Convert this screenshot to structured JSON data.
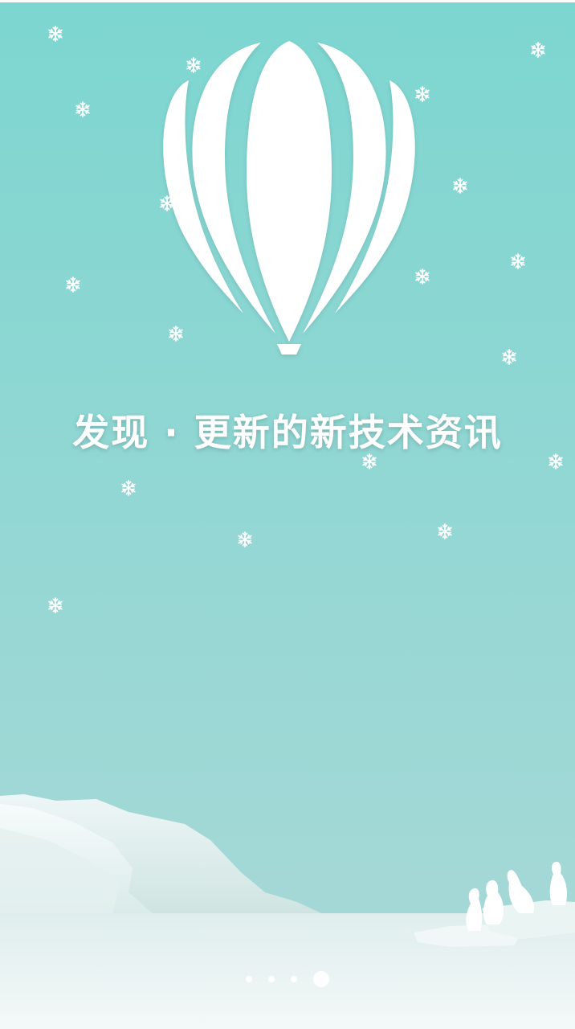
{
  "slogan": "发现 · 更新的新技术资讯",
  "pager": {
    "total": 4,
    "current": 4
  },
  "icons": {
    "balloon": "hot-air-balloon-icon",
    "snowflake": "snowflake-icon",
    "penguins": "penguins-icon",
    "iceberg": "iceberg-icon"
  },
  "colors": {
    "sky_top": "#7dd6d0",
    "sky_bottom": "#a8d9d7",
    "snow": "#ffffff",
    "ice": "#e6f2f1"
  }
}
